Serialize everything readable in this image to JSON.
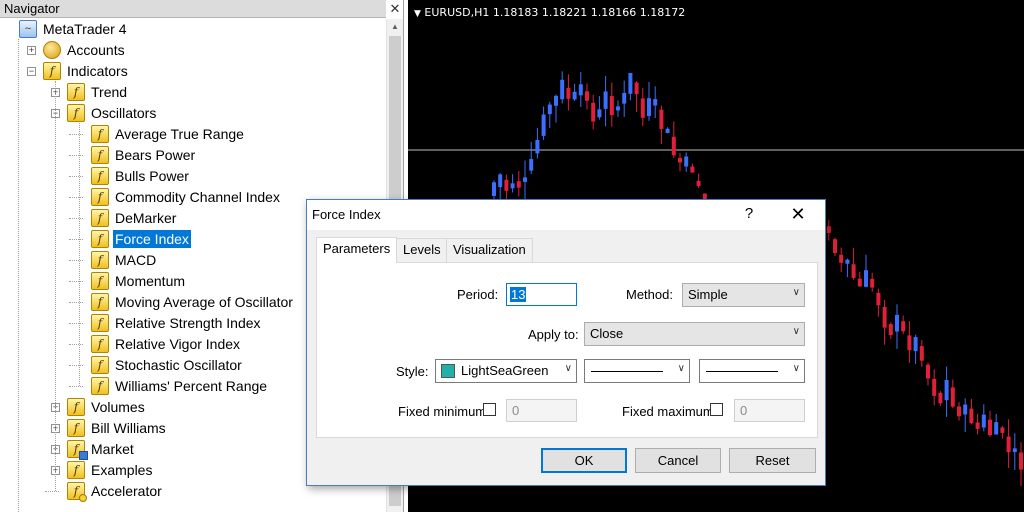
{
  "navigator": {
    "title": "Navigator",
    "items": [
      {
        "label": "MetaTrader 4",
        "icon": "terminal-icon",
        "level": 0,
        "expander": ""
      },
      {
        "label": "Accounts",
        "icon": "accounts-icon",
        "level": 1,
        "expander": "+"
      },
      {
        "label": "Indicators",
        "icon": "function-icon",
        "level": 1,
        "expander": "-"
      },
      {
        "label": "Trend",
        "icon": "function-icon",
        "level": 2,
        "expander": "+"
      },
      {
        "label": "Oscillators",
        "icon": "function-icon",
        "level": 2,
        "expander": "-"
      },
      {
        "label": "Average True Range",
        "icon": "function-icon",
        "level": 3,
        "expander": ""
      },
      {
        "label": "Bears Power",
        "icon": "function-icon",
        "level": 3,
        "expander": ""
      },
      {
        "label": "Bulls Power",
        "icon": "function-icon",
        "level": 3,
        "expander": ""
      },
      {
        "label": "Commodity Channel Index",
        "icon": "function-icon",
        "level": 3,
        "expander": ""
      },
      {
        "label": "DeMarker",
        "icon": "function-icon",
        "level": 3,
        "expander": ""
      },
      {
        "label": "Force Index",
        "icon": "function-icon",
        "level": 3,
        "expander": "",
        "selected": true
      },
      {
        "label": "MACD",
        "icon": "function-icon",
        "level": 3,
        "expander": ""
      },
      {
        "label": "Momentum",
        "icon": "function-icon",
        "level": 3,
        "expander": ""
      },
      {
        "label": "Moving Average of Oscillator",
        "icon": "function-icon",
        "level": 3,
        "expander": ""
      },
      {
        "label": "Relative Strength Index",
        "icon": "function-icon",
        "level": 3,
        "expander": ""
      },
      {
        "label": "Relative Vigor Index",
        "icon": "function-icon",
        "level": 3,
        "expander": ""
      },
      {
        "label": "Stochastic Oscillator",
        "icon": "function-icon",
        "level": 3,
        "expander": ""
      },
      {
        "label": "Williams' Percent Range",
        "icon": "function-icon",
        "level": 3,
        "expander": ""
      },
      {
        "label": "Volumes",
        "icon": "function-icon",
        "level": 2,
        "expander": "+"
      },
      {
        "label": "Bill Williams",
        "icon": "function-icon",
        "level": 2,
        "expander": "+"
      },
      {
        "label": "Market",
        "icon": "market-icon",
        "level": 2,
        "expander": "+"
      },
      {
        "label": "Examples",
        "icon": "function-icon",
        "level": 2,
        "expander": "+"
      },
      {
        "label": "Accelerator",
        "icon": "custom-function-icon",
        "level": 2,
        "expander": ""
      }
    ]
  },
  "chart": {
    "title": "EURUSD,H1  1.18183 1.18221 1.18166 1.18172",
    "colors": {
      "background": "#000000",
      "bull": "#3b6fff",
      "bear": "#e0203a",
      "crosshair": "#c0c0c0"
    }
  },
  "dialog": {
    "title": "Force Index",
    "help": "?",
    "close": "✕",
    "tabs": [
      "Parameters",
      "Levels",
      "Visualization"
    ],
    "active_tab": "Parameters",
    "period_label": "Period:",
    "period_value": "13",
    "method_label": "Method:",
    "method_value": "Simple",
    "apply_label": "Apply to:",
    "apply_value": "Close",
    "style_label": "Style:",
    "style_color_name": "LightSeaGreen",
    "style_color": "#20b2aa",
    "fixed_min_label": "Fixed minimum",
    "fixed_min_value": "0",
    "fixed_max_label": "Fixed maximum",
    "fixed_max_value": "0",
    "ok": "OK",
    "cancel": "Cancel",
    "reset": "Reset"
  }
}
